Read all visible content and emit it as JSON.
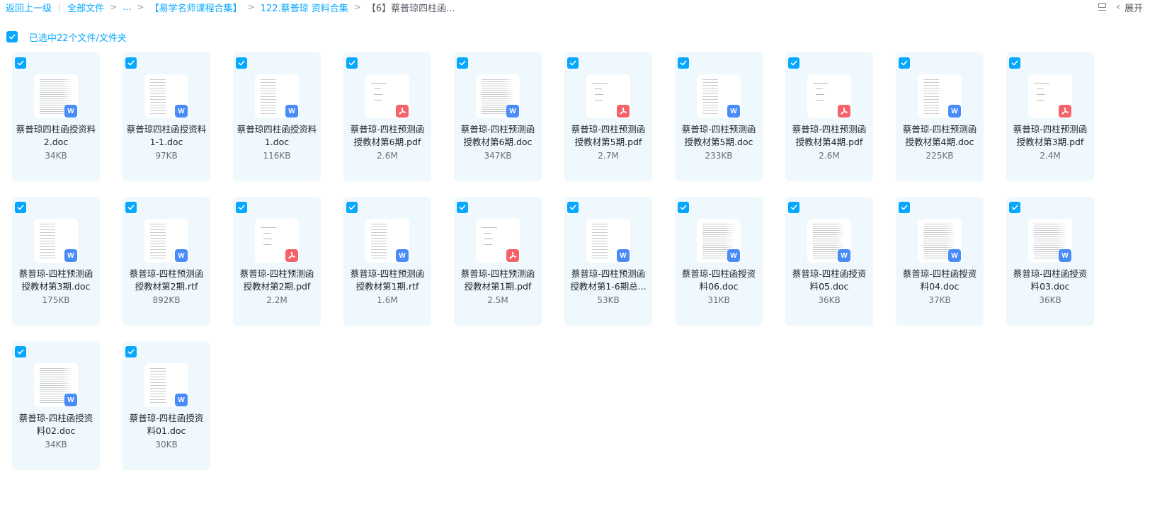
{
  "breadcrumb": {
    "back": "返回上一级",
    "all_files": "全部文件",
    "ellipsis": "...",
    "folder1": "【易学名师课程合集】",
    "folder2": "122.蔡普琼 资料合集",
    "current": "【6】蔡普琼四柱函..."
  },
  "toolbar": {
    "expand_label": "展开"
  },
  "selection": {
    "label": "已选中22个文件/文件夹"
  },
  "icons": {
    "doc": "word-icon",
    "pdf": "pdf-icon",
    "check": "check-icon"
  },
  "colors": {
    "accent": "#06a7ff",
    "card_bg": "#eff8fd",
    "word": "#4a8cf7",
    "pdf": "#f5626a"
  },
  "files": [
    {
      "name": "蔡普琼四柱函授资料2.doc",
      "size": "34KB",
      "type": "doc",
      "preview": "doc"
    },
    {
      "name": "蔡普琼四柱函授资料1-1.doc",
      "size": "97KB",
      "type": "doc",
      "preview": "list"
    },
    {
      "name": "蔡普琼四柱函授资料 1.doc",
      "size": "116KB",
      "type": "doc",
      "preview": "list"
    },
    {
      "name": "蔡普琼-四柱预测函授教材第6期.pdf",
      "size": "2.6M",
      "type": "pdf",
      "preview": "pdf"
    },
    {
      "name": "蔡普琼-四柱预测函授教材第6期.doc",
      "size": "347KB",
      "type": "doc",
      "preview": "doc"
    },
    {
      "name": "蔡普琼-四柱预测函授教材第5期.pdf",
      "size": "2.7M",
      "type": "pdf",
      "preview": "pdf"
    },
    {
      "name": "蔡普琼-四柱预测函授教材第5期.doc",
      "size": "233KB",
      "type": "doc",
      "preview": "list"
    },
    {
      "name": "蔡普琼-四柱预测函授教材第4期.pdf",
      "size": "2.6M",
      "type": "pdf",
      "preview": "pdf"
    },
    {
      "name": "蔡普琼-四柱预测函授教材第4期.doc",
      "size": "225KB",
      "type": "doc",
      "preview": "list"
    },
    {
      "name": "蔡普琼-四柱预测函授教材第3期.pdf",
      "size": "2.4M",
      "type": "pdf",
      "preview": "pdf"
    },
    {
      "name": "蔡普琼-四柱预测函授教材第3期.doc",
      "size": "175KB",
      "type": "doc",
      "preview": "list"
    },
    {
      "name": "蔡普琼-四柱预测函授教材第2期.rtf",
      "size": "892KB",
      "type": "doc",
      "preview": "list"
    },
    {
      "name": "蔡普琼-四柱预测函授教材第2期.pdf",
      "size": "2.2M",
      "type": "pdf",
      "preview": "pdf"
    },
    {
      "name": "蔡普琼-四柱预测函授教材第1期.rtf",
      "size": "1.6M",
      "type": "doc",
      "preview": "list"
    },
    {
      "name": "蔡普琼-四柱预测函授教材第1期.pdf",
      "size": "2.5M",
      "type": "pdf",
      "preview": "pdf"
    },
    {
      "name": "蔡普琼-四柱预测函授教材第1-6期总...",
      "size": "53KB",
      "type": "doc",
      "preview": "list"
    },
    {
      "name": "蔡普琼-四柱函授资料06.doc",
      "size": "31KB",
      "type": "doc",
      "preview": "doc"
    },
    {
      "name": "蔡普琼-四柱函授资料05.doc",
      "size": "36KB",
      "type": "doc",
      "preview": "doc"
    },
    {
      "name": "蔡普琼-四柱函授资料04.doc",
      "size": "37KB",
      "type": "doc",
      "preview": "doc"
    },
    {
      "name": "蔡普琼-四柱函授资料03.doc",
      "size": "36KB",
      "type": "doc",
      "preview": "doc"
    },
    {
      "name": "蔡普琼-四柱函授资料02.doc",
      "size": "34KB",
      "type": "doc",
      "preview": "doc"
    },
    {
      "name": "蔡普琼-四柱函授资料01.doc",
      "size": "30KB",
      "type": "doc",
      "preview": "list"
    }
  ]
}
